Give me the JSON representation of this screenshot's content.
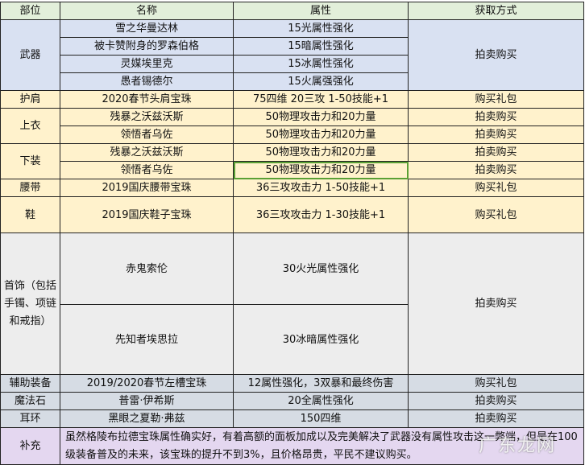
{
  "headers": [
    "部位",
    "名称",
    "属性",
    "获取方式"
  ],
  "weapon": {
    "part": "武器",
    "method": "拍卖购买",
    "items": [
      {
        "name": "雪之华曼达林",
        "attr": "15光属性强化"
      },
      {
        "name": "被卡赞附身的罗森伯格",
        "attr": "15暗属性强化"
      },
      {
        "name": "灵媒埃里克",
        "attr": "15冰属性强化"
      },
      {
        "name": "愚者锡德尔",
        "attr": "15火属强强化"
      }
    ]
  },
  "shoulder": {
    "part": "护肩",
    "name": "2020春节头肩宝珠",
    "attr": "75四维 20三攻 1-50技能+1",
    "method": "购买礼包"
  },
  "top": {
    "part": "上衣",
    "items": [
      {
        "name": "残暴之沃兹沃斯",
        "attr": "50物理攻击力和20力量",
        "method": "拍卖购买"
      },
      {
        "name": "领悟者乌佐",
        "attr": "50物理攻击力和20力量",
        "method": "拍卖购买"
      }
    ]
  },
  "bottom": {
    "part": "下装",
    "items": [
      {
        "name": "残暴之沃兹沃斯",
        "attr": "50物理攻击力和20力量",
        "method": "拍卖购买"
      },
      {
        "name": "领悟者乌佐",
        "attr": "50物理攻击力和20力量",
        "method": "拍卖购买"
      }
    ]
  },
  "belt": {
    "part": "腰带",
    "name": "2019国庆腰带宝珠",
    "attr": "36三攻攻击力 1-50技能+1",
    "method": "购买礼包"
  },
  "shoes": {
    "part": "鞋",
    "name": "2019国庆鞋子宝珠",
    "attr": "36三攻攻击力 1-30技能+1",
    "method": "购买礼包"
  },
  "jewelry": {
    "part": "首饰（包括手镯、项链和戒指）",
    "method": "拍卖购买",
    "items": [
      {
        "name": "赤鬼索伦",
        "attr": "30火光属性强化"
      },
      {
        "name": "先知者埃思拉",
        "attr": "30冰暗属性强化"
      }
    ]
  },
  "support": {
    "part": "辅助装备",
    "name": "2019/2020春节左槽宝珠",
    "attr": "12属性强化，3双暴和最终伤害",
    "method": "购买礼包"
  },
  "magicstone": {
    "part": "魔法石",
    "name": "普雷·伊希斯",
    "attr": "20全属性强化",
    "method": "拍卖购买"
  },
  "earring": {
    "part": "耳环",
    "name": "黑眼之夏勒·弗兹",
    "attr": "150四维",
    "method": "拍卖购买"
  },
  "note": {
    "part": "补充",
    "text": "虽然格陵布拉德宝珠属性确实好，有着高额的面板加成以及完美解决了武器没有属性攻击这一弊端，但是在100级装备普及的未来，该宝珠的提升不到3%，且价格昂贵，平民不建议购买。"
  },
  "watermark": "广东龙网"
}
